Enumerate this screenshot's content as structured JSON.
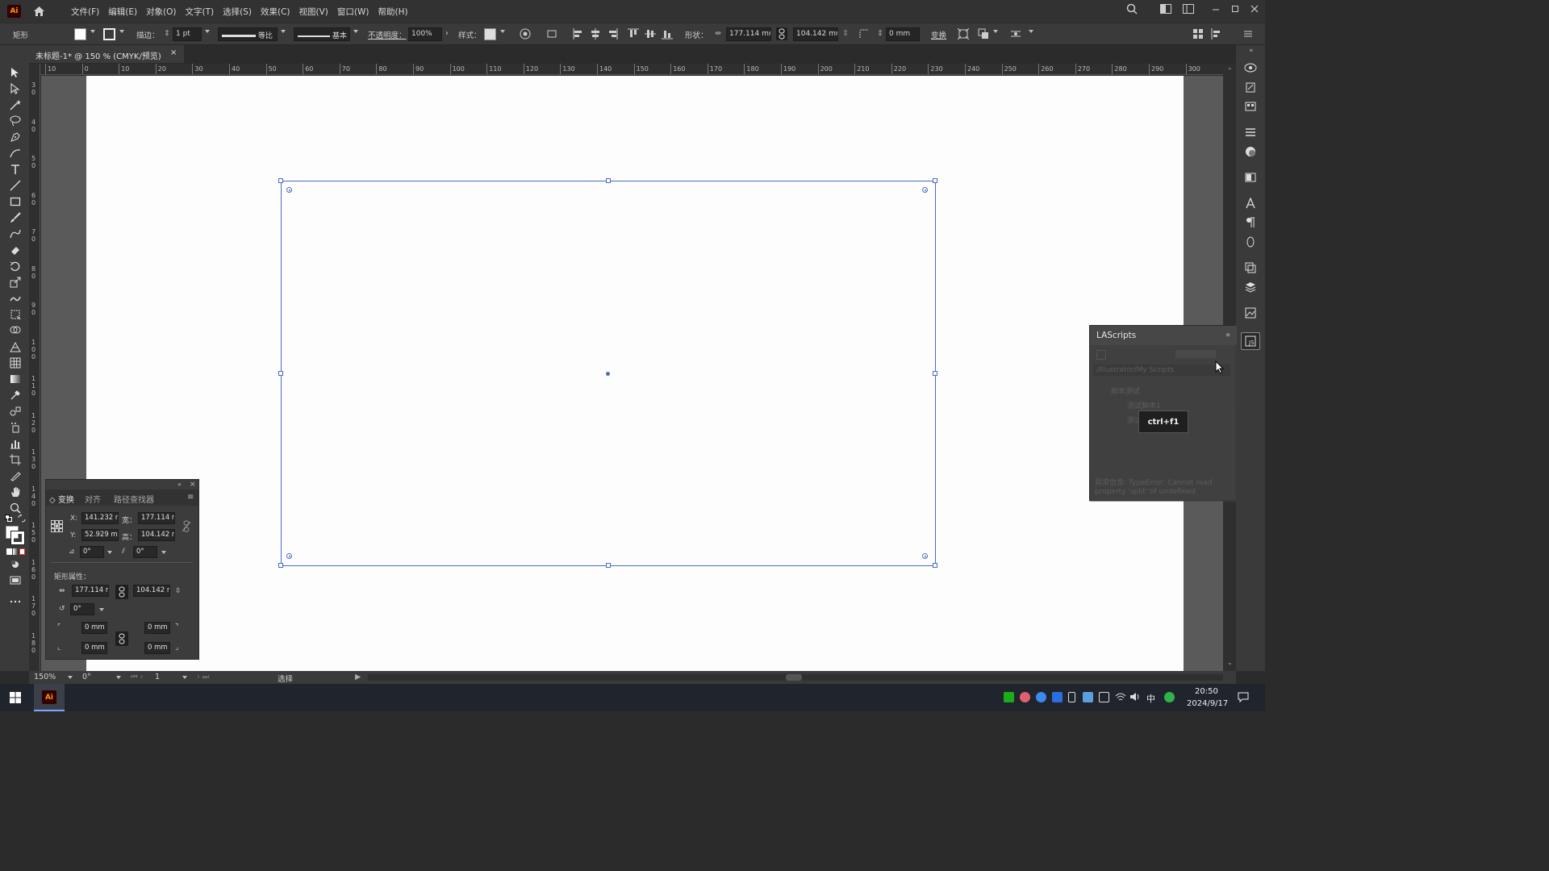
{
  "app": {
    "logo": "Ai"
  },
  "menus": [
    "文件(F)",
    "编辑(E)",
    "对象(O)",
    "文字(T)",
    "选择(S)",
    "效果(C)",
    "视图(V)",
    "窗口(W)",
    "帮助(H)"
  ],
  "control_bar": {
    "object_type": "矩形",
    "stroke_label": "描边：",
    "stroke_weight": "1 pt",
    "stroke_profile": "等比",
    "brush": "基本",
    "opacity_label": "不透明度：",
    "opacity": "100%",
    "style_label": "样式：",
    "shape_label": "形状：",
    "width": "177.114 mm",
    "height": "104.142 mm",
    "corner": "0 mm",
    "transform_label": "变换"
  },
  "document_tab": {
    "title": "未标题-1* @ 150 % (CMYK/预览)",
    "close": "×"
  },
  "rulers": {
    "horizontal": [
      "10",
      "0",
      "10",
      "20",
      "30",
      "40",
      "50",
      "60",
      "70",
      "80",
      "90",
      "100",
      "110",
      "120",
      "130",
      "140",
      "150",
      "160",
      "170",
      "180",
      "190",
      "200",
      "210",
      "220",
      "230",
      "240",
      "250",
      "260",
      "270",
      "280",
      "290",
      "300"
    ],
    "vertical": [
      "30",
      "40",
      "50",
      "60",
      "70",
      "80",
      "90",
      "100",
      "110",
      "120",
      "130",
      "140",
      "150",
      "160",
      "170",
      "180"
    ]
  },
  "lascripts": {
    "title": "LAScripts",
    "collapse": "»",
    "ghost_path": "/Illustrator/My Scripts",
    "ghost_lines": [
      "脚本测试",
      "测试脚本1",
      "测试脚本2  1.2.0"
    ],
    "ghost_error": "异常信息: TypeError: Cannot read property 'split' of undefined",
    "tooltip": "ctrl+f1"
  },
  "transform_panel": {
    "tabs": [
      "◇ 变换",
      "对齐",
      "路径查找器"
    ],
    "x_label": "X:",
    "x": "141.232 r",
    "y_label": "Y:",
    "y": "52.929 mr",
    "w_label": "宽：",
    "w": "177.114 r",
    "h_label": "高：",
    "h": "104.142 r",
    "angle": "0°",
    "shear": "0°",
    "rect_props_label": "矩形属性：",
    "rect_w": "177.114 r",
    "rect_h": "104.142 r",
    "rect_rotation": "0°",
    "corner_tl": "0 mm",
    "corner_tr": "0 mm",
    "corner_bl": "0 mm",
    "corner_br": "0 mm"
  },
  "status_bar": {
    "zoom": "150%",
    "rotation": "0°",
    "artboard": "1",
    "tool": "选择"
  },
  "taskbar": {
    "app_label": "Ai",
    "ime": "中",
    "time": "20:50",
    "date": "2024/9/17"
  },
  "colors": {
    "selection": "#4a6bc4",
    "ai_bg": "#330000",
    "ai_fg": "#ff9a00",
    "artboard": "#fdfdfd",
    "pasteboard": "#5a5a5a"
  }
}
